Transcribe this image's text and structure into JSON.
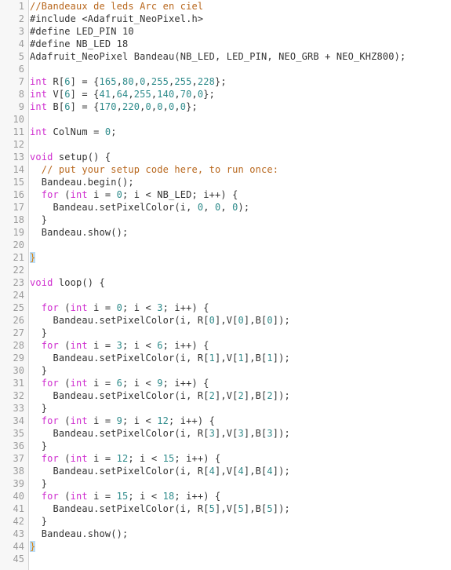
{
  "editor": {
    "name": "arduino-code-editor",
    "language": "C++ / Arduino",
    "total_lines": 45,
    "first_visible_line": 1,
    "last_visible_line": 45,
    "colors": {
      "background": "#ffffff",
      "gutter_background": "#f7f7f7",
      "gutter_border": "#d4d4d4",
      "line_number": "#9a9a9a",
      "plain_text": "#333333",
      "comment": "#b8671d",
      "keyword": "#cf2ecf",
      "number": "#2e8b8b",
      "brace_match_text": "#d9810a",
      "brace_match_background": "#bcdcf5"
    },
    "lines": [
      {
        "n": 1,
        "tokens": [
          {
            "t": "//Bandeaux de leds Arc en ciel",
            "c": "comment"
          }
        ]
      },
      {
        "n": 2,
        "tokens": [
          {
            "t": "#include <Adafruit_NeoPixel.h>",
            "c": "plain"
          }
        ]
      },
      {
        "n": 3,
        "tokens": [
          {
            "t": "#define LED_PIN 10",
            "c": "plain"
          }
        ]
      },
      {
        "n": 4,
        "tokens": [
          {
            "t": "#define NB_LED 18",
            "c": "plain"
          }
        ]
      },
      {
        "n": 5,
        "tokens": [
          {
            "t": "Adafruit_NeoPixel Bandeau(NB_LED, LED_PIN, NEO_GRB + NEO_KHZ800);",
            "c": "plain"
          }
        ]
      },
      {
        "n": 6,
        "tokens": []
      },
      {
        "n": 7,
        "tokens": [
          {
            "t": "int",
            "c": "keyword"
          },
          {
            "t": " R[",
            "c": "plain"
          },
          {
            "t": "6",
            "c": "number"
          },
          {
            "t": "] = {",
            "c": "plain"
          },
          {
            "t": "165",
            "c": "number"
          },
          {
            "t": ",",
            "c": "plain"
          },
          {
            "t": "80",
            "c": "number"
          },
          {
            "t": ",",
            "c": "plain"
          },
          {
            "t": "0",
            "c": "number"
          },
          {
            "t": ",",
            "c": "plain"
          },
          {
            "t": "255",
            "c": "number"
          },
          {
            "t": ",",
            "c": "plain"
          },
          {
            "t": "255",
            "c": "number"
          },
          {
            "t": ",",
            "c": "plain"
          },
          {
            "t": "228",
            "c": "number"
          },
          {
            "t": "};",
            "c": "plain"
          }
        ]
      },
      {
        "n": 8,
        "tokens": [
          {
            "t": "int",
            "c": "keyword"
          },
          {
            "t": " V[",
            "c": "plain"
          },
          {
            "t": "6",
            "c": "number"
          },
          {
            "t": "] = {",
            "c": "plain"
          },
          {
            "t": "41",
            "c": "number"
          },
          {
            "t": ",",
            "c": "plain"
          },
          {
            "t": "64",
            "c": "number"
          },
          {
            "t": ",",
            "c": "plain"
          },
          {
            "t": "255",
            "c": "number"
          },
          {
            "t": ",",
            "c": "plain"
          },
          {
            "t": "140",
            "c": "number"
          },
          {
            "t": ",",
            "c": "plain"
          },
          {
            "t": "70",
            "c": "number"
          },
          {
            "t": ",",
            "c": "plain"
          },
          {
            "t": "0",
            "c": "number"
          },
          {
            "t": "};",
            "c": "plain"
          }
        ]
      },
      {
        "n": 9,
        "tokens": [
          {
            "t": "int",
            "c": "keyword"
          },
          {
            "t": " B[",
            "c": "plain"
          },
          {
            "t": "6",
            "c": "number"
          },
          {
            "t": "] = {",
            "c": "plain"
          },
          {
            "t": "170",
            "c": "number"
          },
          {
            "t": ",",
            "c": "plain"
          },
          {
            "t": "220",
            "c": "number"
          },
          {
            "t": ",",
            "c": "plain"
          },
          {
            "t": "0",
            "c": "number"
          },
          {
            "t": ",",
            "c": "plain"
          },
          {
            "t": "0",
            "c": "number"
          },
          {
            "t": ",",
            "c": "plain"
          },
          {
            "t": "0",
            "c": "number"
          },
          {
            "t": ",",
            "c": "plain"
          },
          {
            "t": "0",
            "c": "number"
          },
          {
            "t": "};",
            "c": "plain"
          }
        ]
      },
      {
        "n": 10,
        "tokens": []
      },
      {
        "n": 11,
        "tokens": [
          {
            "t": "int",
            "c": "keyword"
          },
          {
            "t": " ColNum = ",
            "c": "plain"
          },
          {
            "t": "0",
            "c": "number"
          },
          {
            "t": ";",
            "c": "plain"
          }
        ]
      },
      {
        "n": 12,
        "tokens": []
      },
      {
        "n": 13,
        "tokens": [
          {
            "t": "void",
            "c": "keyword"
          },
          {
            "t": " setup() {",
            "c": "plain"
          }
        ]
      },
      {
        "n": 14,
        "tokens": [
          {
            "t": "  // put your setup code here, to run once:",
            "c": "comment"
          }
        ]
      },
      {
        "n": 15,
        "tokens": [
          {
            "t": "  Bandeau.begin();",
            "c": "plain"
          }
        ]
      },
      {
        "n": 16,
        "tokens": [
          {
            "t": "  ",
            "c": "plain"
          },
          {
            "t": "for",
            "c": "keyword"
          },
          {
            "t": " (",
            "c": "plain"
          },
          {
            "t": "int",
            "c": "keyword"
          },
          {
            "t": " i = ",
            "c": "plain"
          },
          {
            "t": "0",
            "c": "number"
          },
          {
            "t": "; i < NB_LED; i++) {",
            "c": "plain"
          }
        ]
      },
      {
        "n": 17,
        "tokens": [
          {
            "t": "    Bandeau.setPixelColor(i, ",
            "c": "plain"
          },
          {
            "t": "0",
            "c": "number"
          },
          {
            "t": ", ",
            "c": "plain"
          },
          {
            "t": "0",
            "c": "number"
          },
          {
            "t": ", ",
            "c": "plain"
          },
          {
            "t": "0",
            "c": "number"
          },
          {
            "t": ");",
            "c": "plain"
          }
        ]
      },
      {
        "n": 18,
        "tokens": [
          {
            "t": "  }",
            "c": "plain"
          }
        ]
      },
      {
        "n": 19,
        "tokens": [
          {
            "t": "  Bandeau.show();",
            "c": "plain"
          }
        ]
      },
      {
        "n": 20,
        "tokens": []
      },
      {
        "n": 21,
        "tokens": [
          {
            "t": "}",
            "c": "brace-match"
          }
        ]
      },
      {
        "n": 22,
        "tokens": []
      },
      {
        "n": 23,
        "tokens": [
          {
            "t": "void",
            "c": "keyword"
          },
          {
            "t": " loop() {",
            "c": "plain"
          }
        ]
      },
      {
        "n": 24,
        "tokens": []
      },
      {
        "n": 25,
        "tokens": [
          {
            "t": "  ",
            "c": "plain"
          },
          {
            "t": "for",
            "c": "keyword"
          },
          {
            "t": " (",
            "c": "plain"
          },
          {
            "t": "int",
            "c": "keyword"
          },
          {
            "t": " i = ",
            "c": "plain"
          },
          {
            "t": "0",
            "c": "number"
          },
          {
            "t": "; i < ",
            "c": "plain"
          },
          {
            "t": "3",
            "c": "number"
          },
          {
            "t": "; i++) {",
            "c": "plain"
          }
        ]
      },
      {
        "n": 26,
        "tokens": [
          {
            "t": "    Bandeau.setPixelColor(i, R[",
            "c": "plain"
          },
          {
            "t": "0",
            "c": "number"
          },
          {
            "t": "],V[",
            "c": "plain"
          },
          {
            "t": "0",
            "c": "number"
          },
          {
            "t": "],B[",
            "c": "plain"
          },
          {
            "t": "0",
            "c": "number"
          },
          {
            "t": "]);",
            "c": "plain"
          }
        ]
      },
      {
        "n": 27,
        "tokens": [
          {
            "t": "  }",
            "c": "plain"
          }
        ]
      },
      {
        "n": 28,
        "tokens": [
          {
            "t": "  ",
            "c": "plain"
          },
          {
            "t": "for",
            "c": "keyword"
          },
          {
            "t": " (",
            "c": "plain"
          },
          {
            "t": "int",
            "c": "keyword"
          },
          {
            "t": " i = ",
            "c": "plain"
          },
          {
            "t": "3",
            "c": "number"
          },
          {
            "t": "; i < ",
            "c": "plain"
          },
          {
            "t": "6",
            "c": "number"
          },
          {
            "t": "; i++) {",
            "c": "plain"
          }
        ]
      },
      {
        "n": 29,
        "tokens": [
          {
            "t": "    Bandeau.setPixelColor(i, R[",
            "c": "plain"
          },
          {
            "t": "1",
            "c": "number"
          },
          {
            "t": "],V[",
            "c": "plain"
          },
          {
            "t": "1",
            "c": "number"
          },
          {
            "t": "],B[",
            "c": "plain"
          },
          {
            "t": "1",
            "c": "number"
          },
          {
            "t": "]);",
            "c": "plain"
          }
        ]
      },
      {
        "n": 30,
        "tokens": [
          {
            "t": "  }",
            "c": "plain"
          }
        ]
      },
      {
        "n": 31,
        "tokens": [
          {
            "t": "  ",
            "c": "plain"
          },
          {
            "t": "for",
            "c": "keyword"
          },
          {
            "t": " (",
            "c": "plain"
          },
          {
            "t": "int",
            "c": "keyword"
          },
          {
            "t": " i = ",
            "c": "plain"
          },
          {
            "t": "6",
            "c": "number"
          },
          {
            "t": "; i < ",
            "c": "plain"
          },
          {
            "t": "9",
            "c": "number"
          },
          {
            "t": "; i++) {",
            "c": "plain"
          }
        ]
      },
      {
        "n": 32,
        "tokens": [
          {
            "t": "    Bandeau.setPixelColor(i, R[",
            "c": "plain"
          },
          {
            "t": "2",
            "c": "number"
          },
          {
            "t": "],V[",
            "c": "plain"
          },
          {
            "t": "2",
            "c": "number"
          },
          {
            "t": "],B[",
            "c": "plain"
          },
          {
            "t": "2",
            "c": "number"
          },
          {
            "t": "]);",
            "c": "plain"
          }
        ]
      },
      {
        "n": 33,
        "tokens": [
          {
            "t": "  }",
            "c": "plain"
          }
        ]
      },
      {
        "n": 34,
        "tokens": [
          {
            "t": "  ",
            "c": "plain"
          },
          {
            "t": "for",
            "c": "keyword"
          },
          {
            "t": " (",
            "c": "plain"
          },
          {
            "t": "int",
            "c": "keyword"
          },
          {
            "t": " i = ",
            "c": "plain"
          },
          {
            "t": "9",
            "c": "number"
          },
          {
            "t": "; i < ",
            "c": "plain"
          },
          {
            "t": "12",
            "c": "number"
          },
          {
            "t": "; i++) {",
            "c": "plain"
          }
        ]
      },
      {
        "n": 35,
        "tokens": [
          {
            "t": "    Bandeau.setPixelColor(i, R[",
            "c": "plain"
          },
          {
            "t": "3",
            "c": "number"
          },
          {
            "t": "],V[",
            "c": "plain"
          },
          {
            "t": "3",
            "c": "number"
          },
          {
            "t": "],B[",
            "c": "plain"
          },
          {
            "t": "3",
            "c": "number"
          },
          {
            "t": "]);",
            "c": "plain"
          }
        ]
      },
      {
        "n": 36,
        "tokens": [
          {
            "t": "  }",
            "c": "plain"
          }
        ]
      },
      {
        "n": 37,
        "tokens": [
          {
            "t": "  ",
            "c": "plain"
          },
          {
            "t": "for",
            "c": "keyword"
          },
          {
            "t": " (",
            "c": "plain"
          },
          {
            "t": "int",
            "c": "keyword"
          },
          {
            "t": " i = ",
            "c": "plain"
          },
          {
            "t": "12",
            "c": "number"
          },
          {
            "t": "; i < ",
            "c": "plain"
          },
          {
            "t": "15",
            "c": "number"
          },
          {
            "t": "; i++) {",
            "c": "plain"
          }
        ]
      },
      {
        "n": 38,
        "tokens": [
          {
            "t": "    Bandeau.setPixelColor(i, R[",
            "c": "plain"
          },
          {
            "t": "4",
            "c": "number"
          },
          {
            "t": "],V[",
            "c": "plain"
          },
          {
            "t": "4",
            "c": "number"
          },
          {
            "t": "],B[",
            "c": "plain"
          },
          {
            "t": "4",
            "c": "number"
          },
          {
            "t": "]);",
            "c": "plain"
          }
        ]
      },
      {
        "n": 39,
        "tokens": [
          {
            "t": "  }",
            "c": "plain"
          }
        ]
      },
      {
        "n": 40,
        "tokens": [
          {
            "t": "  ",
            "c": "plain"
          },
          {
            "t": "for",
            "c": "keyword"
          },
          {
            "t": " (",
            "c": "plain"
          },
          {
            "t": "int",
            "c": "keyword"
          },
          {
            "t": " i = ",
            "c": "plain"
          },
          {
            "t": "15",
            "c": "number"
          },
          {
            "t": "; i < ",
            "c": "plain"
          },
          {
            "t": "18",
            "c": "number"
          },
          {
            "t": "; i++) {",
            "c": "plain"
          }
        ]
      },
      {
        "n": 41,
        "tokens": [
          {
            "t": "    Bandeau.setPixelColor(i, R[",
            "c": "plain"
          },
          {
            "t": "5",
            "c": "number"
          },
          {
            "t": "],V[",
            "c": "plain"
          },
          {
            "t": "5",
            "c": "number"
          },
          {
            "t": "],B[",
            "c": "plain"
          },
          {
            "t": "5",
            "c": "number"
          },
          {
            "t": "]);",
            "c": "plain"
          }
        ]
      },
      {
        "n": 42,
        "tokens": [
          {
            "t": "  }",
            "c": "plain"
          }
        ]
      },
      {
        "n": 43,
        "tokens": [
          {
            "t": "  Bandeau.show();",
            "c": "plain"
          }
        ]
      },
      {
        "n": 44,
        "tokens": [
          {
            "t": "}",
            "c": "brace-match"
          }
        ]
      },
      {
        "n": 45,
        "tokens": []
      }
    ]
  }
}
